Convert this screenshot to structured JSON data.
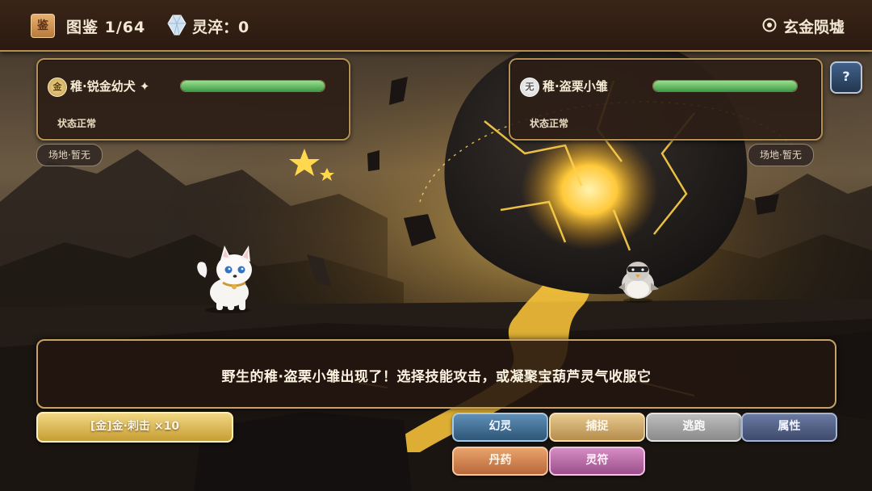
{
  "topbar": {
    "codex_icon_glyph": "鉴",
    "codex_label": "图鉴 1/64",
    "essence_label": "灵淬：0",
    "location_label": "玄金陨墟",
    "icons": [
      "codex-icon",
      "crystal-icon",
      "location-target-icon"
    ]
  },
  "player": {
    "element_glyph": "金",
    "name": "稚·锐金幼犬 ✦",
    "hp_fraction": 1.0,
    "status": "状态正常",
    "field": "场地·暂无"
  },
  "enemy": {
    "element_glyph": "无",
    "name": "稚·盗栗小雏",
    "hp_fraction": 1.0,
    "status": "状态正常",
    "field": "场地·暂无"
  },
  "help_label": "?",
  "message": "野生的稚·盗栗小雏出现了！选择技能攻击，或凝聚宝葫芦灵气收服它",
  "skill_button": "[金]金·刺击 ×10",
  "actions": {
    "spirit": "幻灵",
    "capture": "捕捉",
    "flee": "逃跑",
    "attributes": "属性",
    "pill": "丹药",
    "talisman": "灵符"
  },
  "colors": {
    "panel_border": "#b68f55",
    "hp_green": "#5fbf5f",
    "skill_gold": "#d9b14a",
    "lava": "#ffc93a"
  }
}
